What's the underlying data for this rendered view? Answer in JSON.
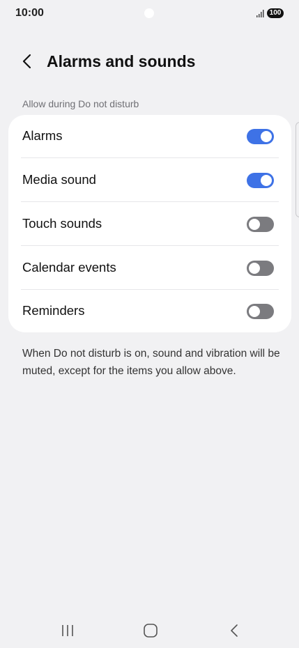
{
  "status_bar": {
    "time": "10:00",
    "battery": "100",
    "signal_icon": "signal-bars-icon"
  },
  "header": {
    "back_icon": "chevron-left-icon",
    "title": "Alarms and sounds"
  },
  "section": {
    "label": "Allow during Do not disturb"
  },
  "settings": [
    {
      "label": "Alarms",
      "enabled": true
    },
    {
      "label": "Media sound",
      "enabled": true
    },
    {
      "label": "Touch sounds",
      "enabled": false
    },
    {
      "label": "Calendar events",
      "enabled": false
    },
    {
      "label": "Reminders",
      "enabled": false
    }
  ],
  "footer_note": "When Do not disturb is on, sound and vibration will be muted, except for the items you allow above.",
  "colors": {
    "toggle_on": "#3e72e6",
    "toggle_off": "#7b7b7f",
    "background": "#f1f1f3"
  },
  "nav_bar": {
    "recents_icon": "recents-icon",
    "home_icon": "home-icon",
    "back_icon": "back-icon"
  }
}
